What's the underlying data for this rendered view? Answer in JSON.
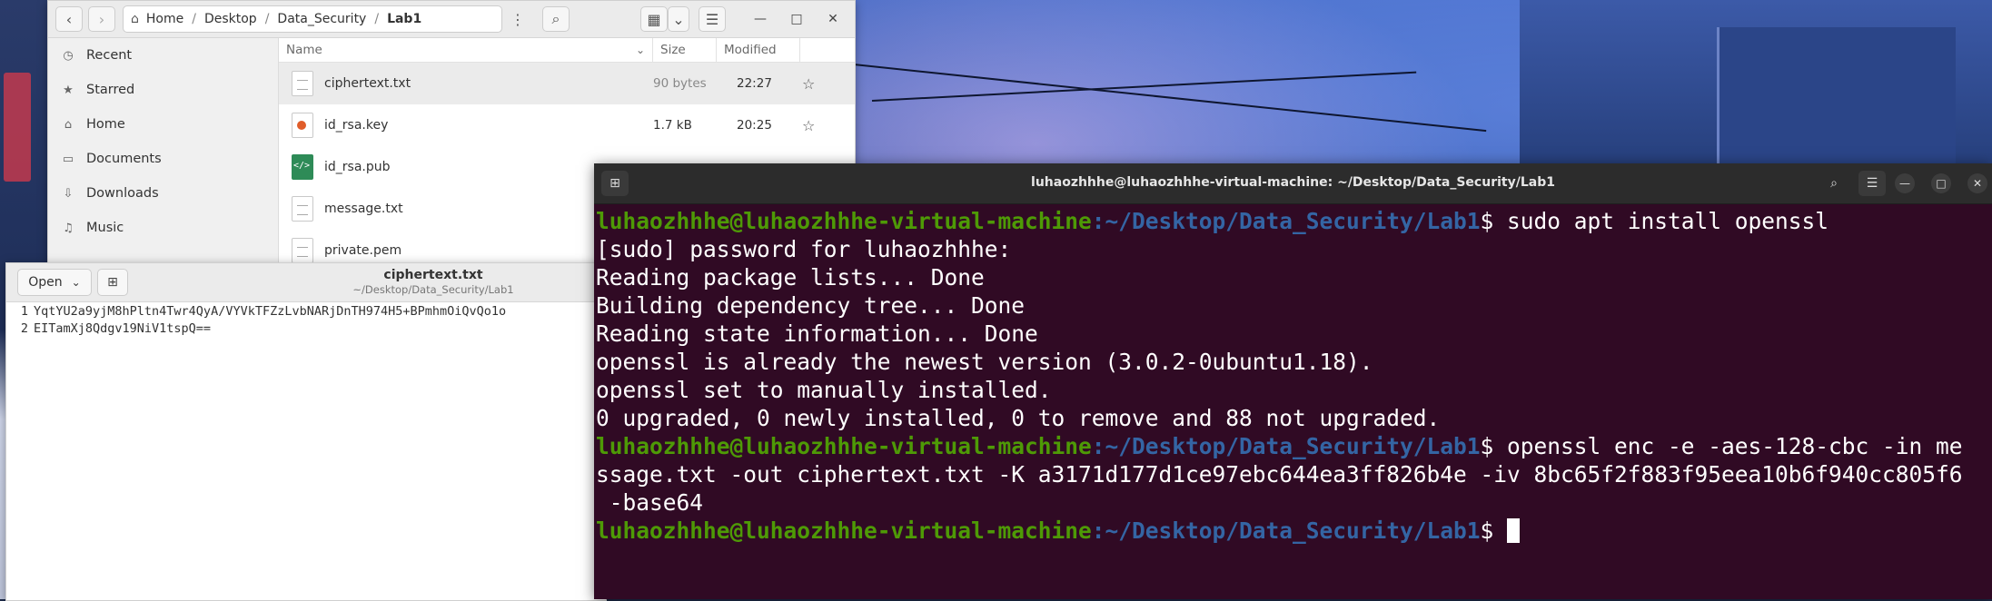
{
  "files": {
    "path": [
      "Home",
      "Desktop",
      "Data_Security",
      "Lab1"
    ],
    "sidebar": [
      {
        "label": "Recent",
        "icon": "clock-icon"
      },
      {
        "label": "Starred",
        "icon": "star-icon"
      },
      {
        "label": "Home",
        "icon": "home-icon"
      },
      {
        "label": "Documents",
        "icon": "document-icon"
      },
      {
        "label": "Downloads",
        "icon": "download-icon"
      },
      {
        "label": "Music",
        "icon": "music-icon"
      }
    ],
    "columns": {
      "name": "Name",
      "size": "Size",
      "modified": "Modified"
    },
    "rows": [
      {
        "name": "ciphertext.txt",
        "size": "90 bytes",
        "modified": "22:27"
      },
      {
        "name": "id_rsa.key",
        "size": "1.7 kB",
        "modified": "20:25"
      },
      {
        "name": "id_rsa.pub",
        "size": "",
        "modified": ""
      },
      {
        "name": "message.txt",
        "size": "",
        "modified": ""
      },
      {
        "name": "private.pem",
        "size": "",
        "modified": ""
      }
    ]
  },
  "editor": {
    "open_label": "Open",
    "title": "ciphertext.txt",
    "subtitle": "~/Desktop/Data_Security/Lab1",
    "lines": [
      {
        "num": "1",
        "text": "YqtYU2a9yjM8hPltn4Twr4QyA/VYVkTFZzLvbNARjDnTH974H5+BPmhmOiQvQo1o"
      },
      {
        "num": "2",
        "text": "EITamXj8Qdgv19NiV1tspQ=="
      }
    ]
  },
  "terminal": {
    "title": "luhaozhhhe@luhaozhhhe-virtual-machine: ~/Desktop/Data_Security/Lab1",
    "prompt_user": "luhaozhhhe@luhaozhhhe-virtual-machine",
    "prompt_path": ":~/Desktop/Data_Security/Lab1",
    "prompt_symbol": "$ ",
    "cmd1": "sudo apt install openssl",
    "out": [
      "[sudo] password for luhaozhhhe:",
      "Reading package lists... Done",
      "Building dependency tree... Done",
      "Reading state information... Done",
      "openssl is already the newest version (3.0.2-0ubuntu1.18).",
      "openssl set to manually installed.",
      "0 upgraded, 0 newly installed, 0 to remove and 88 not upgraded."
    ],
    "cmd2_part1": "openssl enc -e -aes-128-cbc -in me",
    "cmd2_part2": "ssage.txt -out ciphertext.txt -K a3171d177d1ce97ebc644ea3ff826b4e -iv 8bc65f2f883f95eea10b6f940cc805f6",
    "cmd2_part3": " -base64"
  }
}
